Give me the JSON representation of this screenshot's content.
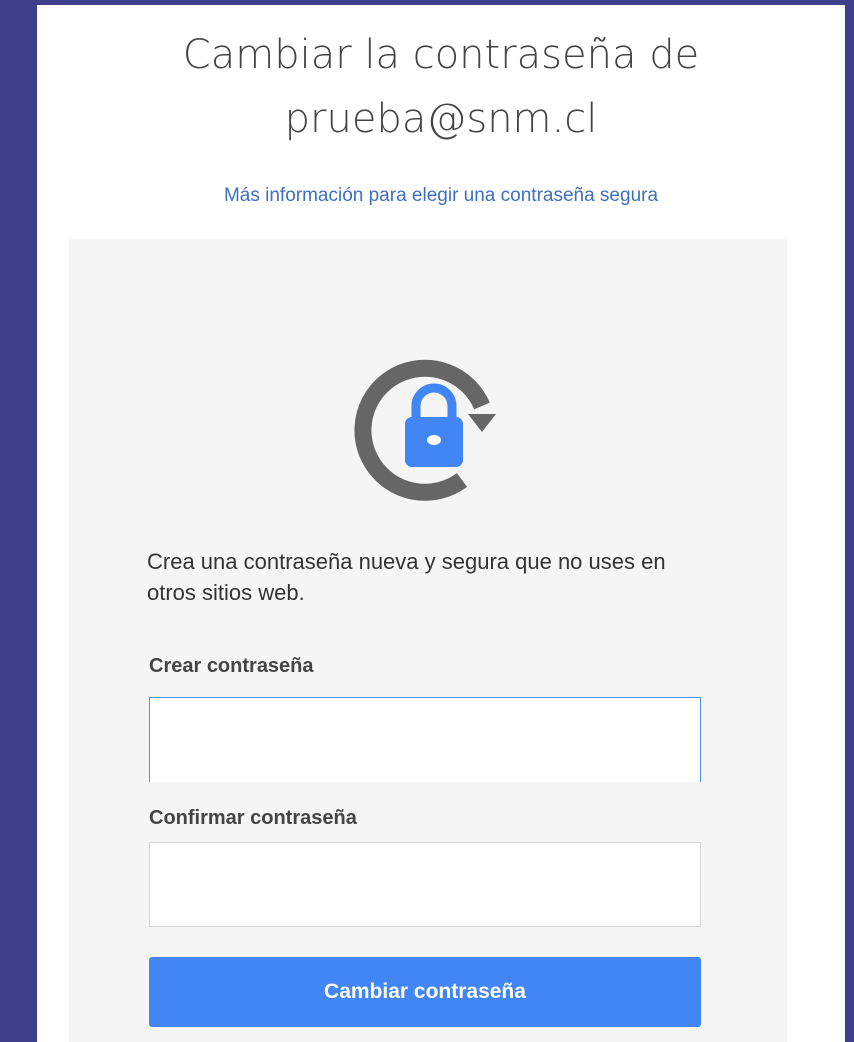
{
  "header": {
    "title_line1": "Cambiar la contraseña de",
    "title_line2": "prueba@snm.cl",
    "help_link": "Más información para elegir una contraseña segura"
  },
  "card": {
    "icon": "lock-refresh-icon",
    "description": "Crea una contraseña nueva y segura que no uses en otros sitios web.",
    "new_password_label": "Crear contraseña",
    "new_password_value": "",
    "confirm_password_label": "Confirmar contraseña",
    "confirm_password_value": "",
    "submit_label": "Cambiar contraseña"
  },
  "colors": {
    "page_background": "#3f3f8c",
    "accent": "#4285f4",
    "link": "#3f6fbf",
    "icon_gray": "#666666"
  }
}
